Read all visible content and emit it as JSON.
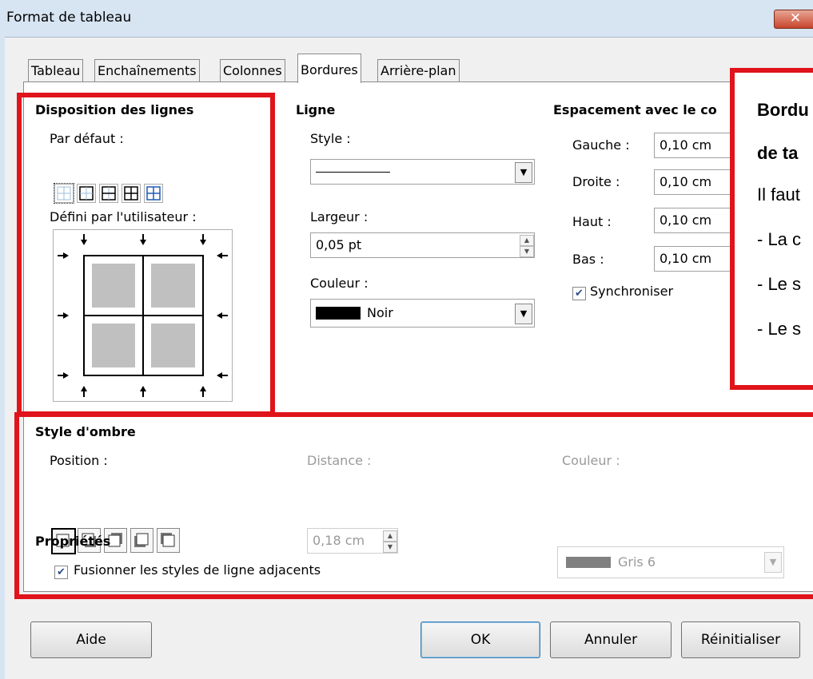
{
  "window": {
    "title": "Format de tableau",
    "close_glyph": "✕"
  },
  "tabs": [
    {
      "label": "Tableau",
      "active": false
    },
    {
      "label": "Enchaînements",
      "active": false
    },
    {
      "label": "Colonnes",
      "active": false
    },
    {
      "label": "Bordures",
      "active": true
    },
    {
      "label": "Arrière-plan",
      "active": false
    }
  ],
  "line_arrangement": {
    "heading": "Disposition des lignes",
    "default_label": "Par défaut :",
    "user_defined_label": "Défini par l'utilisateur :"
  },
  "line": {
    "heading": "Ligne",
    "style_label": "Style :",
    "width_label": "Largeur :",
    "width_value": "0,05 pt",
    "color_label": "Couleur :",
    "color_value": "Noir",
    "color_swatch": "#000000"
  },
  "padding": {
    "heading": "Espacement avec le co",
    "left_label": "Gauche :",
    "left_value": "0,10 cm",
    "right_label": "Droite :",
    "right_value": "0,10 cm",
    "top_label": "Haut :",
    "top_value": "0,10 cm",
    "bottom_label": "Bas :",
    "bottom_value": "0,10 cm",
    "sync_label": "Synchroniser",
    "sync_checked": true
  },
  "shadow": {
    "heading": "Style d'ombre",
    "position_label": "Position :",
    "distance_label": "Distance :",
    "distance_value": "0,18 cm",
    "color_label": "Couleur :",
    "color_value": "Gris 6",
    "color_swatch": "#808080"
  },
  "properties": {
    "heading": "Propriétés",
    "merge_label": "Fusionner les styles de ligne adjacents",
    "merge_checked": true
  },
  "buttons": {
    "help": "Aide",
    "ok": "OK",
    "cancel": "Annuler",
    "reset": "Réinitialiser"
  },
  "callout": {
    "line1": "Bordu",
    "line2": "de ta",
    "line3": "Il faut",
    "line4": "- La c",
    "line5": "- Le s",
    "line6": "- Le s"
  },
  "colors": {
    "highlight": "#e0141b",
    "checkmark": "#2b4f8c"
  }
}
